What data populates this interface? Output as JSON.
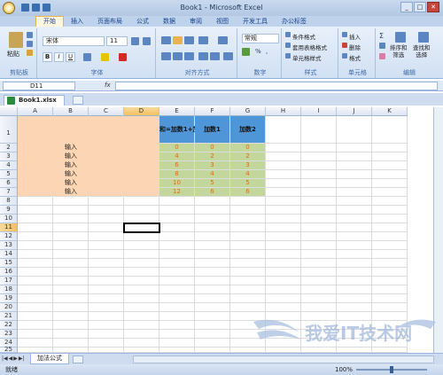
{
  "window": {
    "title": "Book1 - Microsoft Excel",
    "controls": [
      "_",
      "□",
      "✕"
    ]
  },
  "ribbon_tabs": [
    "开始",
    "插入",
    "页面布局",
    "公式",
    "数据",
    "审阅",
    "视图",
    "开发工具",
    "办公标签"
  ],
  "ribbon": {
    "clipboard": {
      "paste": "粘贴",
      "label": "剪贴板"
    },
    "font": {
      "name": "宋体",
      "size": "11",
      "label": "字体",
      "bold": "B",
      "italic": "I",
      "underline": "U"
    },
    "alignment": {
      "label": "对齐方式"
    },
    "number": {
      "format": "常规",
      "label": "数字",
      "percent": "%",
      "comma": ","
    },
    "styles": {
      "conditional": "条件格式",
      "table": "套用表格格式",
      "cell": "单元格样式",
      "label": "样式"
    },
    "cells": {
      "insert": "插入",
      "delete": "删除",
      "format": "格式",
      "label": "单元格"
    },
    "editing": {
      "sort": "排序和\n筛选",
      "find": "查找和\n选择",
      "label": "编辑"
    }
  },
  "formula_bar": {
    "name_box": "D11",
    "fx": "fx",
    "value": ""
  },
  "document_tab": "Book1.xlsx",
  "columns": [
    "A",
    "B",
    "C",
    "D",
    "E",
    "F",
    "G",
    "H",
    "I",
    "J",
    "K"
  ],
  "rows": [
    "1",
    "2",
    "3",
    "4",
    "5",
    "6",
    "7",
    "8",
    "9",
    "10",
    "11",
    "12",
    "13",
    "14",
    "15",
    "16",
    "17",
    "18",
    "19",
    "20",
    "21",
    "22",
    "23",
    "24",
    "25"
  ],
  "table": {
    "headers": [
      "和=加数1+加数2",
      "加数1",
      "加数2"
    ],
    "input_label": "输入",
    "rows": [
      [
        "0",
        "0",
        "0"
      ],
      [
        "4",
        "2",
        "2"
      ],
      [
        "6",
        "3",
        "3"
      ],
      [
        "8",
        "4",
        "4"
      ],
      [
        "10",
        "5",
        "5"
      ],
      [
        "12",
        "6",
        "6"
      ]
    ]
  },
  "selected_cell": "D11",
  "sheet_tab": "加法公式",
  "status": {
    "ready": "就绪",
    "zoom": "100%"
  },
  "watermark": "我爱IT技术网",
  "colors": {
    "peach": "#fcd5b4",
    "header_blue": "#4f96d8",
    "green": "#c3d69b",
    "number_orange": "#e46c0a"
  }
}
